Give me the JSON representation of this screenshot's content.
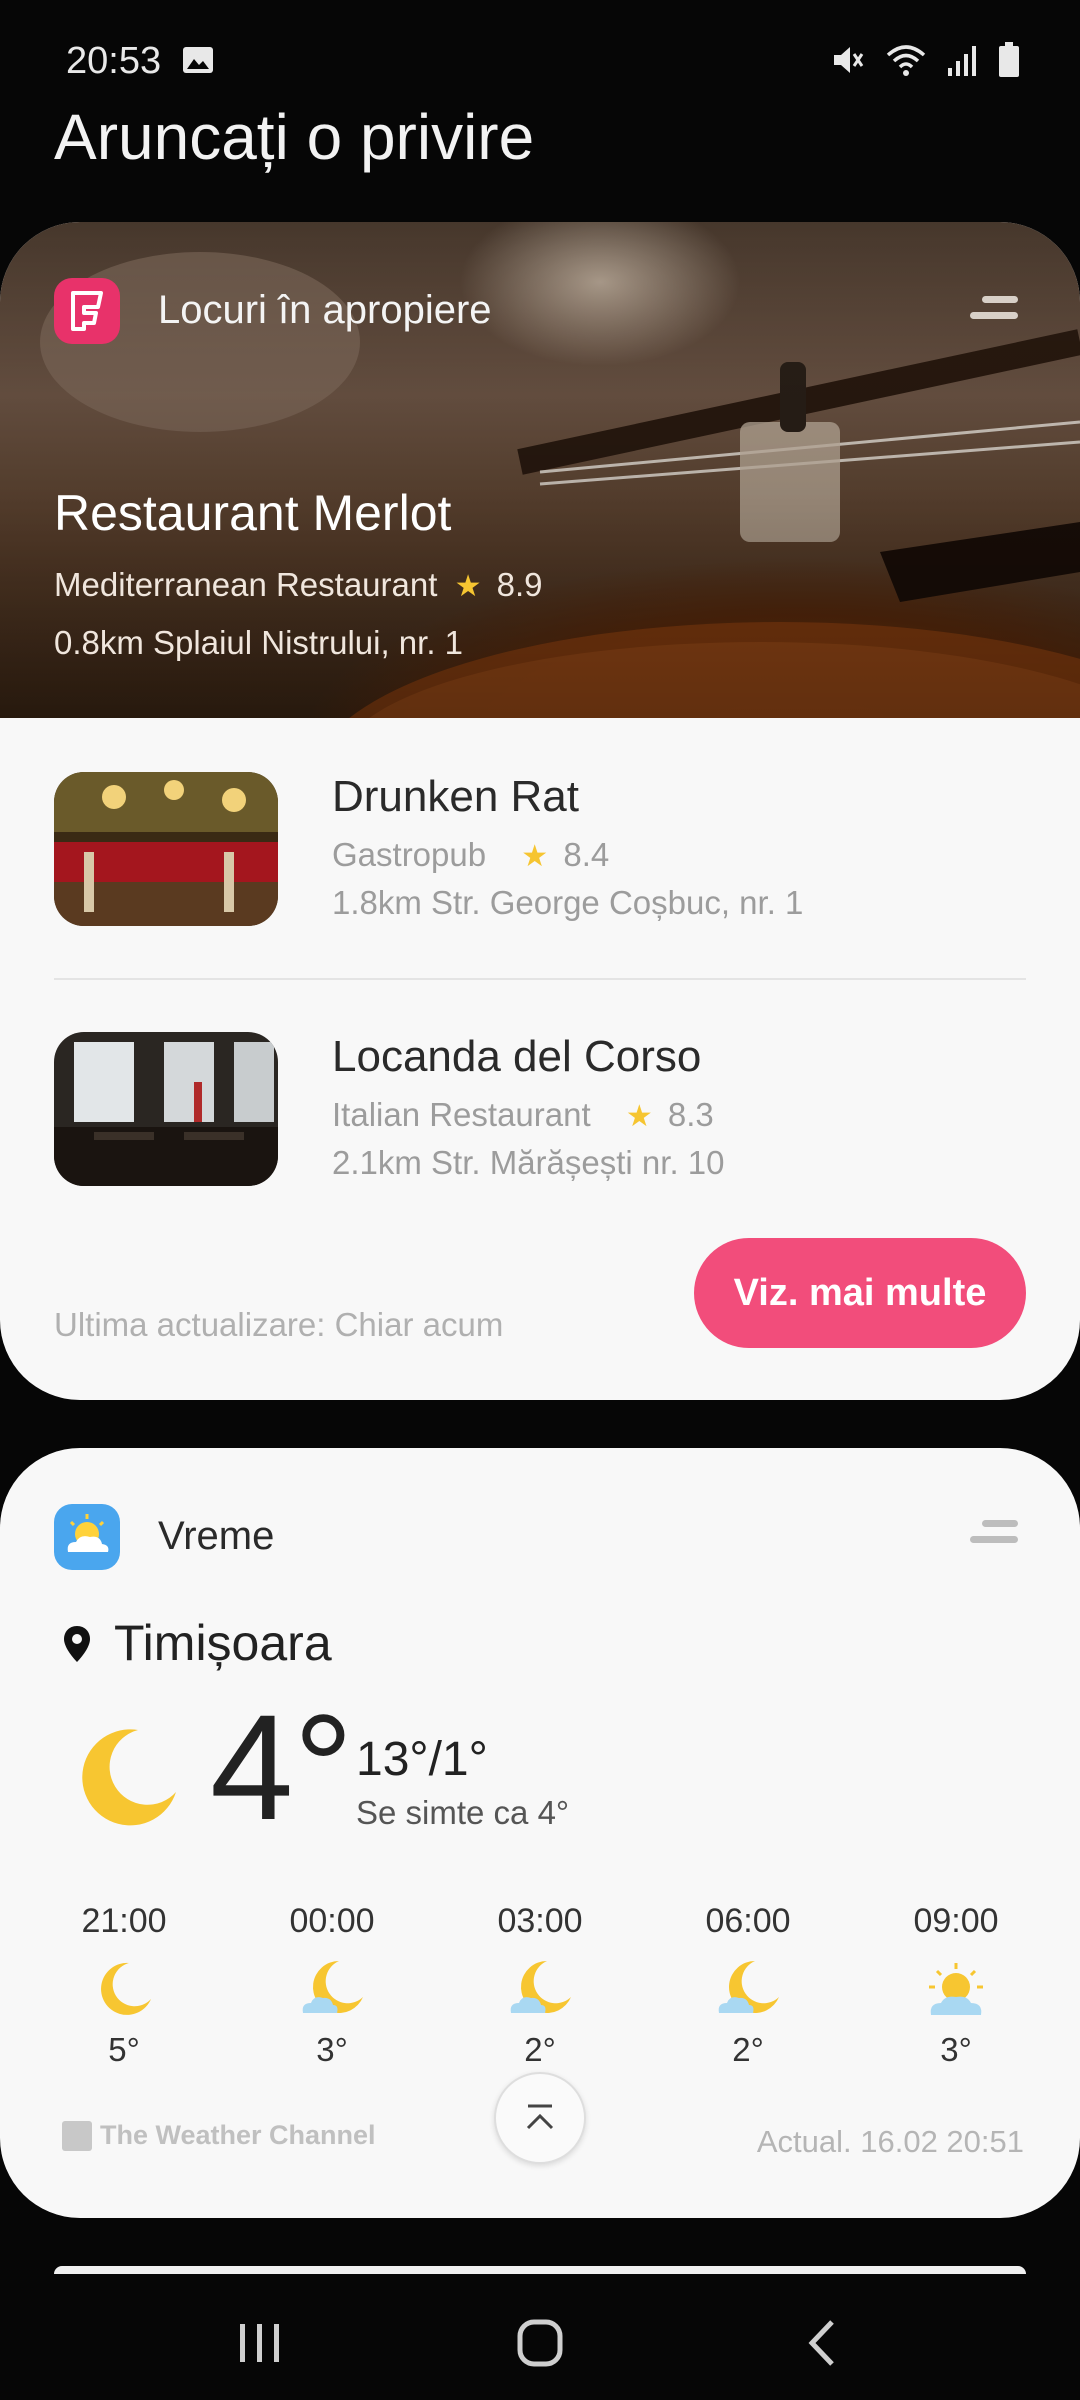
{
  "status_bar": {
    "time": "20:53",
    "icons": [
      "gallery-icon",
      "mute-icon",
      "wifi-icon",
      "signal-icon",
      "battery-icon"
    ]
  },
  "page_title": "Aruncați o privire",
  "places_card": {
    "header_label": "Locuri în apropiere",
    "featured": {
      "name": "Restaurant Merlot",
      "category": "Mediterranean Restaurant",
      "rating": "8.9",
      "address": "0.8km Splaiul Nistrului, nr. 1"
    },
    "items": [
      {
        "name": "Drunken Rat",
        "category": "Gastropub",
        "rating": "8.4",
        "address": "1.8km Str. George Coșbuc, nr. 1"
      },
      {
        "name": "Locanda del Corso",
        "category": "Italian Restaurant",
        "rating": "8.3",
        "address": "2.1km Str. Mărășești nr. 10"
      }
    ],
    "last_update": "Ultima actualizare: Chiar acum",
    "more_button": "Viz. mai multe",
    "colors": {
      "accent": "#f24d7b",
      "logo": "#e8326a",
      "star": "#f6c531"
    }
  },
  "weather_card": {
    "header_label": "Vreme",
    "city": "Timișoara",
    "current_temp": "4°",
    "high_low": "13°/1°",
    "feels_like": "Se simte ca 4°",
    "forecast": [
      {
        "time": "21:00",
        "icon": "moon-icon",
        "temp": "5°"
      },
      {
        "time": "00:00",
        "icon": "moon-cloud-icon",
        "temp": "3°"
      },
      {
        "time": "03:00",
        "icon": "moon-cloud-icon",
        "temp": "2°"
      },
      {
        "time": "06:00",
        "icon": "moon-cloud-icon",
        "temp": "2°"
      },
      {
        "time": "09:00",
        "icon": "sun-cloud-icon",
        "temp": "3°"
      }
    ],
    "provider": "The Weather Channel",
    "updated": "Actual. 16.02 20:51"
  },
  "nav_bar": {
    "buttons": [
      "recents-icon",
      "home-icon",
      "back-icon"
    ]
  }
}
